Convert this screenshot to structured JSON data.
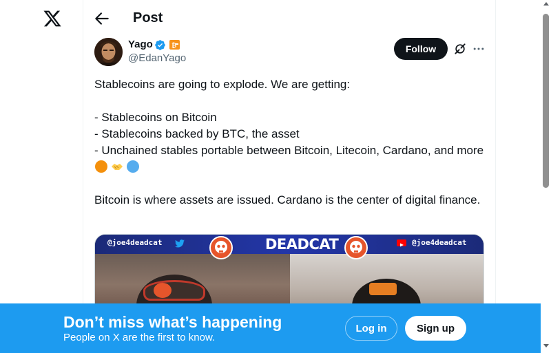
{
  "nav": {
    "logo_icon": "x-logo-icon"
  },
  "header": {
    "back_icon": "arrow-left-icon",
    "title": "Post"
  },
  "post": {
    "author": {
      "name": "Yago",
      "handle": "@EdanYago",
      "verified_icon": "verified-badge-icon",
      "affiliate_icon": "bitcoin-affiliate-badge-icon"
    },
    "follow_label": "Follow",
    "grok_icon": "grok-icon",
    "more_icon": "more-horizontal-icon",
    "text": {
      "line1": "Stablecoins are going to explode. We are getting:",
      "bullet1": "- Stablecoins on Bitcoin",
      "bullet2": "- Stablecoins backed by BTC, the asset",
      "bullet3": "- Unchained stables portable between Bitcoin, Litecoin, Cardano, and more",
      "para2": "Bitcoin is where assets are issued. Cardano is the center of digital finance."
    },
    "emojis": [
      "orange-circle-icon",
      "handshake-icon",
      "blue-circle-icon"
    ],
    "media": {
      "banner_left": "@joe4deadcat",
      "banner_title": "DEADCAT",
      "banner_right": "@joe4deadcat",
      "left_icon": "twitter-bird-icon",
      "right_icon": "youtube-icon"
    }
  },
  "bottom_bar": {
    "heading": "Don’t miss what’s happening",
    "subheading": "People on X are the first to know.",
    "login_label": "Log in",
    "signup_label": "Sign up"
  },
  "colors": {
    "accent": "#1d9bf0",
    "text_primary": "#0f1419",
    "text_secondary": "#536471",
    "affiliate_orange": "#f7931a"
  }
}
